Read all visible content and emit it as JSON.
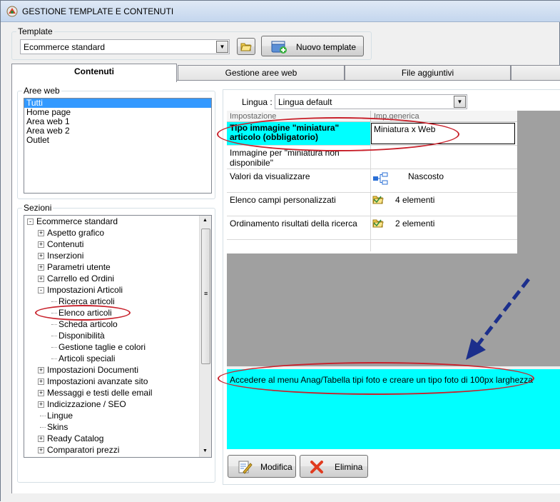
{
  "window": {
    "title": "GESTIONE TEMPLATE E CONTENUTI"
  },
  "template_group": {
    "legend": "Template",
    "selected": "Ecommerce standard",
    "new_button": "Nuovo template"
  },
  "tabs": [
    {
      "label": "Contenuti"
    },
    {
      "label": "Gestione aree web"
    },
    {
      "label": "File aggiuntivi"
    }
  ],
  "aree_web": {
    "legend": "Aree web",
    "items": [
      "Tutti",
      "Home page",
      "Area web 1",
      "Area web 2",
      "Outlet"
    ],
    "selected_index": 0
  },
  "sezioni": {
    "legend": "Sezioni",
    "root": "Ecommerce standard",
    "items": [
      "Aspetto grafico",
      "Contenuti",
      "Inserzioni",
      "Parametri utente",
      "Carrello ed Ordini",
      "Impostazioni Articoli",
      "Ricerca articoli",
      "Elenco articoli",
      "Scheda articolo",
      "Disponibilità",
      "Gestione taglie e colori",
      "Articoli speciali",
      "Impostazioni Documenti",
      "Impostazioni avanzate sito",
      "Messaggi e testi delle email",
      "Indicizzazione / SEO",
      "Lingue",
      "Skins",
      "Ready Catalog",
      "Comparatori prezzi"
    ]
  },
  "lingua": {
    "label": "Lingua :",
    "selected": "Lingua default"
  },
  "grid": {
    "headers": [
      "Impostazione",
      "Imp.generica"
    ],
    "rows": [
      {
        "name": "Tipo immagine \"miniatura\" articolo (obbligatorio)",
        "value": "Miniatura x Web"
      },
      {
        "name": "Immagine per \"miniatura non disponibile\"",
        "value": ""
      },
      {
        "name": "Valori da visualizzare",
        "value": "Nascosto"
      },
      {
        "name": "Elenco campi personalizzati",
        "value": "4 elementi"
      },
      {
        "name": "Ordinamento risultati della ricerca",
        "value": "2 elementi"
      }
    ]
  },
  "description": "Accedere al menu Anag/Tabella tipi foto e creare un tipo foto di 100px larghezza",
  "buttons": {
    "modifica": "Modifica",
    "elimina": "Elimina"
  },
  "colors": {
    "highlight": "#00ffff",
    "annotation": "#c8212b",
    "arrow": "#1c2f8c",
    "selection": "#3399ff"
  }
}
